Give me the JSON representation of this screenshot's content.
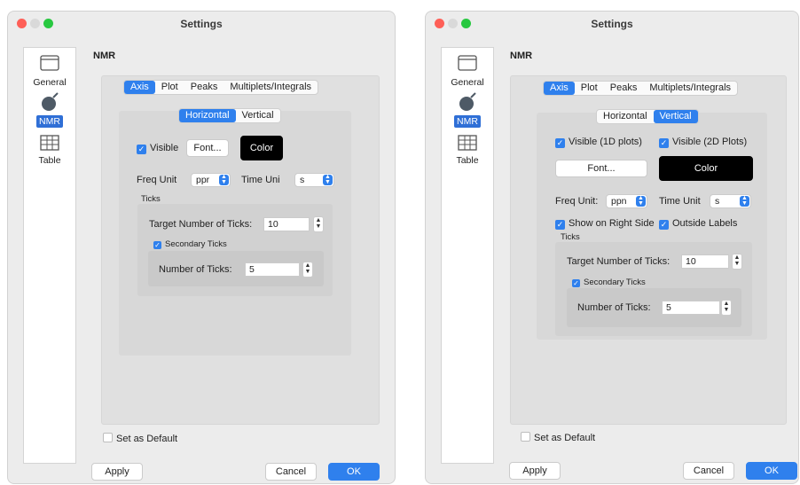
{
  "window_title": "Settings",
  "sidebar": {
    "general": "General",
    "nmr": "NMR",
    "table": "Table"
  },
  "section_title": "NMR",
  "tabs": [
    "Axis",
    "Plot",
    "Peaks",
    "Multiplets/Integrals"
  ],
  "subtabs": [
    "Horizontal",
    "Vertical"
  ],
  "left": {
    "visible": "Visible",
    "font_button": "Font...",
    "color_button": "Color",
    "freq_unit_label": "Freq Unit",
    "freq_unit_value": "ppr",
    "time_unit_label": "Time Uni",
    "time_unit_value": "s",
    "ticks_label": "Ticks",
    "target_ticks_label": "Target Number of Ticks:",
    "target_ticks_value": "10",
    "secondary_ticks": "Secondary Ticks",
    "num_ticks_label": "Number of Ticks:",
    "num_ticks_value": "5",
    "set_default": "Set as Default",
    "apply": "Apply",
    "cancel": "Cancel",
    "ok": "OK"
  },
  "right": {
    "visible_1d": "Visible (1D plots)",
    "visible_2d": "Visible (2D Plots)",
    "font_button": "Font...",
    "color_button": "Color",
    "freq_unit_label": "Freq Unit:",
    "freq_unit_value": "ppn",
    "time_unit_label": "Time Unit",
    "time_unit_value": "s",
    "show_right_side": "Show on Right Side",
    "outside_labels": "Outside Labels",
    "ticks_label": "Ticks",
    "target_ticks_label": "Target Number of Ticks:",
    "target_ticks_value": "10",
    "secondary_ticks": "Secondary Ticks",
    "num_ticks_label": "Number of Ticks:",
    "num_ticks_value": "5",
    "set_default": "Set as Default",
    "apply": "Apply",
    "cancel": "Cancel",
    "ok": "OK"
  },
  "colors": {
    "accent": "#2f80ed",
    "close": "#fe5f57",
    "minimize": "#febc2e",
    "zoom": "#28c840"
  }
}
